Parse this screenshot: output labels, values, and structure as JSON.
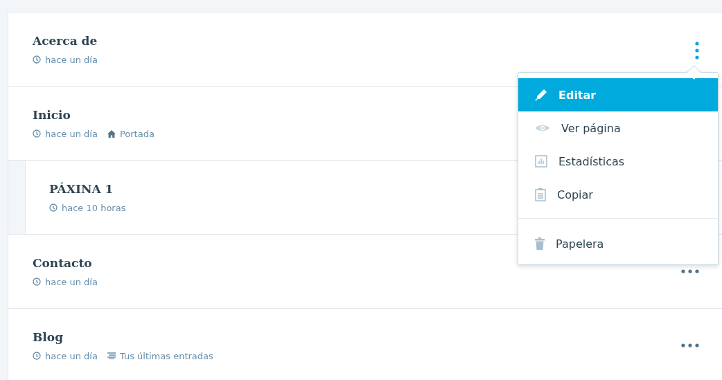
{
  "pages": [
    {
      "title": "Acerca de",
      "time": "hace un día",
      "menu_open": true
    },
    {
      "title": "Inicio",
      "time": "hace un día",
      "tag": {
        "kind": "home",
        "text": "Portada"
      },
      "children": [
        {
          "title": "PÁXINA 1",
          "time": "hace 10 horas"
        }
      ]
    },
    {
      "title": "Contacto",
      "time": "hace un día",
      "menu_open": false
    },
    {
      "title": "Blog",
      "time": "hace un día",
      "tag": {
        "kind": "posts",
        "text": "Tus últimas entradas"
      },
      "menu_open": false
    }
  ],
  "menu": {
    "items": [
      {
        "label": "Editar",
        "selected": true,
        "divider_before": false
      },
      {
        "label": "Ver página",
        "selected": false,
        "divider_before": false
      },
      {
        "label": "Estadísticas",
        "selected": false,
        "divider_before": false
      },
      {
        "label": "Copiar",
        "selected": false,
        "divider_before": false
      },
      {
        "label": "Papelera",
        "selected": false,
        "divider_before": true
      }
    ]
  }
}
